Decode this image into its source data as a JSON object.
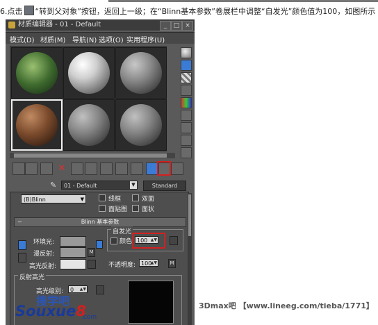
{
  "caption": {
    "step_prefix": "6.点击",
    "step_rest": "“转到父对象”按钮，返回上一级；在“Blinn基本参数”卷展栏中调整“自发光”颜色值为100，如图所示"
  },
  "window": {
    "title": "材质编辑器 - 01 - Default",
    "controls": [
      "_",
      "□",
      "×"
    ]
  },
  "menu": [
    "模式(D)",
    "材质(M)",
    "导航(N)",
    "选项(O)",
    "实用程序(U)"
  ],
  "slots": [
    {
      "name": "plant",
      "color": "#4a7a3a"
    },
    {
      "name": "white",
      "color": "#d8d8d8"
    },
    {
      "name": "gray",
      "color": "#909090"
    },
    {
      "name": "brown",
      "color": "#8a5a3a"
    },
    {
      "name": "gray",
      "color": "#8a8a8a"
    },
    {
      "name": "gray",
      "color": "#8a8a8a"
    }
  ],
  "material": {
    "name": "01 - Default",
    "type_button": "Standard"
  },
  "shader": {
    "selected": "(B)Blinn",
    "options": {
      "wire": "线框",
      "two_sided": "双面",
      "face_map": "面贴图",
      "faceted": "面状"
    }
  },
  "blinn": {
    "title": "Blinn 基本参数",
    "ambient": "环境光:",
    "diffuse": "漫反射:",
    "specular": "高光反射:",
    "map_btn": "M",
    "self_illum": {
      "group": "自发光",
      "color_label": "颜色",
      "value": "100"
    },
    "opacity": {
      "label": "不透明度:",
      "value": "100",
      "map_btn": "M"
    }
  },
  "highlights": {
    "group": "反射高光",
    "spec_level": "高光级别:",
    "spec_value": "0"
  },
  "logo": {
    "line1": "搜学吧",
    "sou": "Souxue",
    "eight": "8",
    "com": ".com"
  },
  "watermark": "3Dmax吧 【www.lineeg.com/tieba/1771】",
  "colors": {
    "highlight": "#d42020",
    "accent_blue": "#3a7bd5"
  }
}
